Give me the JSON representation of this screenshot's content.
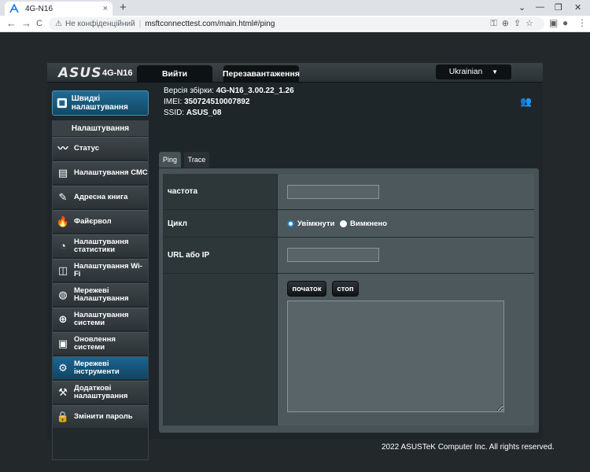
{
  "browser": {
    "tab_title": "4G-N16",
    "tab_close": "×",
    "new_tab": "+",
    "back": "←",
    "forward": "→",
    "reload": "C",
    "security_label": "Не конфіденційний",
    "url": "msftconnecttest.com/main.html#/ping",
    "window_min": "—",
    "window_max": "❐",
    "window_close": "✕"
  },
  "router": {
    "logo": "ASUS",
    "model": "4G-N16",
    "logout_label": "Вийти",
    "reboot_label": "Перезавантаження",
    "language": "Ukrainian",
    "firmware_label": "Версія збірки:",
    "firmware_value": "4G-N16_3.00.22_1.26",
    "imei_label": "IMEI:",
    "imei_value": "350724510007892",
    "ssid_label": "SSID:",
    "ssid_value": "ASUS_08"
  },
  "sidebar": {
    "quick_setup": "Швидкі налаштування",
    "section_title": "Налаштування",
    "items": [
      {
        "label": "Статус",
        "icon": "status-icon"
      },
      {
        "label": "Налаштування СМС",
        "icon": "sms-icon"
      },
      {
        "label": "Адресна книга",
        "icon": "address-book-icon"
      },
      {
        "label": "Файєрвол",
        "icon": "firewall-icon"
      },
      {
        "label": "Налаштування статистики",
        "icon": "statistics-icon"
      },
      {
        "label": "Налаштування Wi-Fi",
        "icon": "wifi-icon"
      },
      {
        "label": "Мережеві Налаштування",
        "icon": "globe-icon"
      },
      {
        "label": "Налаштування системи",
        "icon": "system-icon"
      },
      {
        "label": "Оновлення системи",
        "icon": "update-icon"
      },
      {
        "label": "Мережеві інструменти",
        "icon": "tools-icon"
      },
      {
        "label": "Додаткові налаштування",
        "icon": "advanced-icon"
      },
      {
        "label": "Змінити пароль",
        "icon": "lock-icon"
      }
    ],
    "active_index": 9
  },
  "content": {
    "tabs": [
      "Ping",
      "Trace"
    ],
    "active_tab": 0,
    "frequency_label": "частота",
    "frequency_value": "",
    "cycle_label": "Цикл",
    "cycle_on": "Увімкнути",
    "cycle_off": "Вимкнено",
    "cycle_selected": "on",
    "url_label": "URL або IP",
    "url_value": "",
    "start_label": "початок",
    "stop_label": "стоп",
    "output": ""
  },
  "footer": "2022 ASUSTeK Computer Inc. All rights reserved.",
  "colors": {
    "accent": "#1c6591",
    "background": "#23282b"
  }
}
